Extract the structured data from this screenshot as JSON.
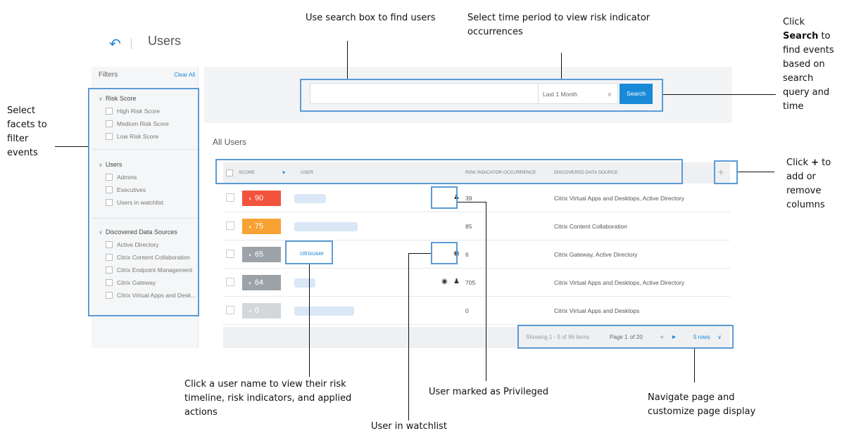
{
  "header": {
    "back_icon": "back-arrow-icon",
    "title": "Users"
  },
  "filters": {
    "title": "Filters",
    "clear_all": "Clear All",
    "sections": [
      {
        "heading": "Risk Score",
        "items": [
          "High Risk Score",
          "Medium Risk Score",
          "Low Risk Score"
        ]
      },
      {
        "heading": "Users",
        "items": [
          "Admins",
          "Executives",
          "Users in watchlist"
        ]
      },
      {
        "heading": "Discovered Data Sources",
        "items": [
          "Active Directory",
          "Citrix Content Collaboration",
          "Citrix Endpoint Management",
          "Citrix Gateway",
          "Citrix Virtual Apps and Desk..."
        ]
      }
    ]
  },
  "search": {
    "input_value": "",
    "time_period": "Last 1 Month",
    "button_label": "Search"
  },
  "table": {
    "section_title": "All Users",
    "columns": [
      "SCORE",
      "USER",
      "RISK INDICATOR OCCURRENCE",
      "DISCOVERED DATA SOURCE"
    ],
    "add_column_label": "+",
    "rows": [
      {
        "score": "90",
        "score_color": "#f2533c",
        "user": "",
        "occurrence": "39",
        "source": "Citrix Virtual Apps and Desktops, Active Directory",
        "badges": [
          "privileged-user-icon"
        ]
      },
      {
        "score": "75",
        "score_color": "#f7a233",
        "user": "",
        "occurrence": "85",
        "source": "Citrix Content Collaboration",
        "badges": []
      },
      {
        "score": "65",
        "score_color": "#9ca3a8",
        "user": "citrixuser",
        "occurrence": "6",
        "source": "Citrix Gateway, Active Directory",
        "badges": [
          "watchlist-eye-icon"
        ]
      },
      {
        "score": "64",
        "score_color": "#9ca3a8",
        "user": "",
        "occurrence": "705",
        "source": "Citrix Virtual Apps and Desktops, Active Directory",
        "badges": [
          "watchlist-eye-icon",
          "privileged-user-icon"
        ]
      },
      {
        "score": "0",
        "score_color": "#d4d7da",
        "user": "",
        "occurrence": "0",
        "source": "Citrix Virtual Apps and Desktops",
        "badges": []
      }
    ]
  },
  "pager": {
    "showing": "Showing 1 - 5 of 96 items",
    "page_prefix": "Page",
    "page_current": "1",
    "page_suffix": "of 20",
    "prev": "◂",
    "next": "▸",
    "rows_per_page": "5 rows"
  },
  "callouts": {
    "search_box": "Use search box to find users",
    "time_period": "Select time period to view risk indicator occurrences",
    "search_button": "Click Search to find events based on search query and time",
    "facets": "Select facets to filter events",
    "plus": "Click + to add or remove columns",
    "user_name": "Click a user name to view their risk timeline, risk indicators, and applied actions",
    "privileged": "User marked as Privileged",
    "watchlist": "User in watchlist",
    "navigate": "Navigate page and customize page display"
  }
}
